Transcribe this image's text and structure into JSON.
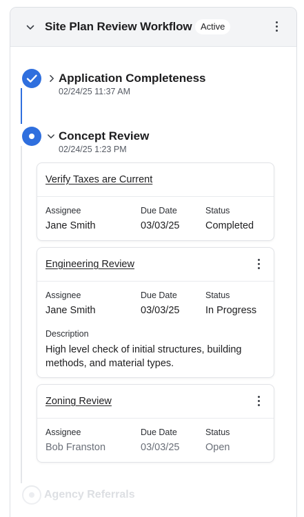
{
  "workflow": {
    "title": "Site Plan Review Workflow",
    "status_badge": "Active",
    "icons": {
      "collapse": "chevron-down-icon",
      "menu": "more-vertical-icon"
    }
  },
  "steps": [
    {
      "title": "Application Completeness",
      "date": "02/24/25 11:37 AM",
      "state": "complete",
      "icon": "check-icon",
      "expanded": false
    },
    {
      "title": "Concept Review",
      "date": "02/24/25 1:23 PM",
      "state": "current",
      "icon": "dot-icon",
      "expanded": true
    },
    {
      "title": "Agency Referrals",
      "state": "upcoming",
      "icon": "dot-icon"
    }
  ],
  "field_labels": {
    "assignee": "Assignee",
    "due_date": "Due Date",
    "status": "Status",
    "description": "Description"
  },
  "tasks": [
    {
      "name": "Verify Taxes are Current",
      "assignee": "Jane Smith",
      "due_date": "03/03/25",
      "status": "Completed",
      "has_menu": false
    },
    {
      "name": "Engineering Review",
      "assignee": "Jane Smith",
      "due_date": "03/03/25",
      "status": "In Progress",
      "has_menu": true,
      "description": "High level check of initial structures, building methods, and material types."
    },
    {
      "name": "Zoning Review",
      "assignee": "Bob Franston",
      "due_date": "03/03/25",
      "status": "Open",
      "has_menu": true
    }
  ],
  "colors": {
    "accent": "#2f6fde",
    "header_bg": "#f3f4f6",
    "border": "#dcdfe4",
    "muted_text": "#d3d6db"
  }
}
